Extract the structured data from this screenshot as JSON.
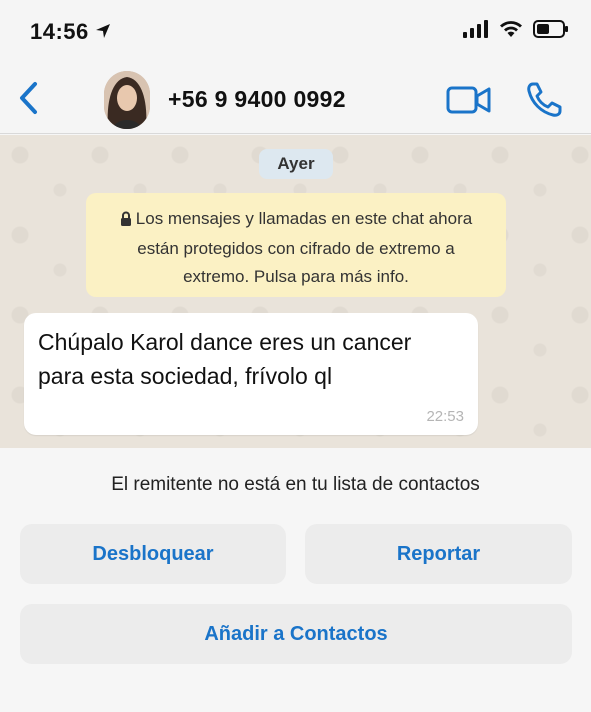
{
  "status_bar": {
    "time": "14:56",
    "icons": [
      "location-arrow-icon",
      "signal-icon",
      "wifi-icon",
      "battery-icon"
    ]
  },
  "header": {
    "contact_name": "+56 9 9400 0992",
    "icons": [
      "back-chevron-icon",
      "video-call-icon",
      "phone-call-icon"
    ],
    "accent_color": "#1a74c9"
  },
  "chat": {
    "date_label": "Ayer",
    "encryption_notice": "Los mensajes y llamadas en este chat ahora están protegidos con cifrado de extremo a extremo. Pulsa para más info.",
    "messages": [
      {
        "text": "Chúpalo Karol dance eres un cancer para esta sociedad, frívolo ql",
        "time": "22:53"
      }
    ]
  },
  "bottom_panel": {
    "sender_note": "El remitente no está en tu lista de contactos",
    "unblock_label": "Desbloquear",
    "report_label": "Reportar",
    "add_contact_label": "Añadir a Contactos"
  }
}
